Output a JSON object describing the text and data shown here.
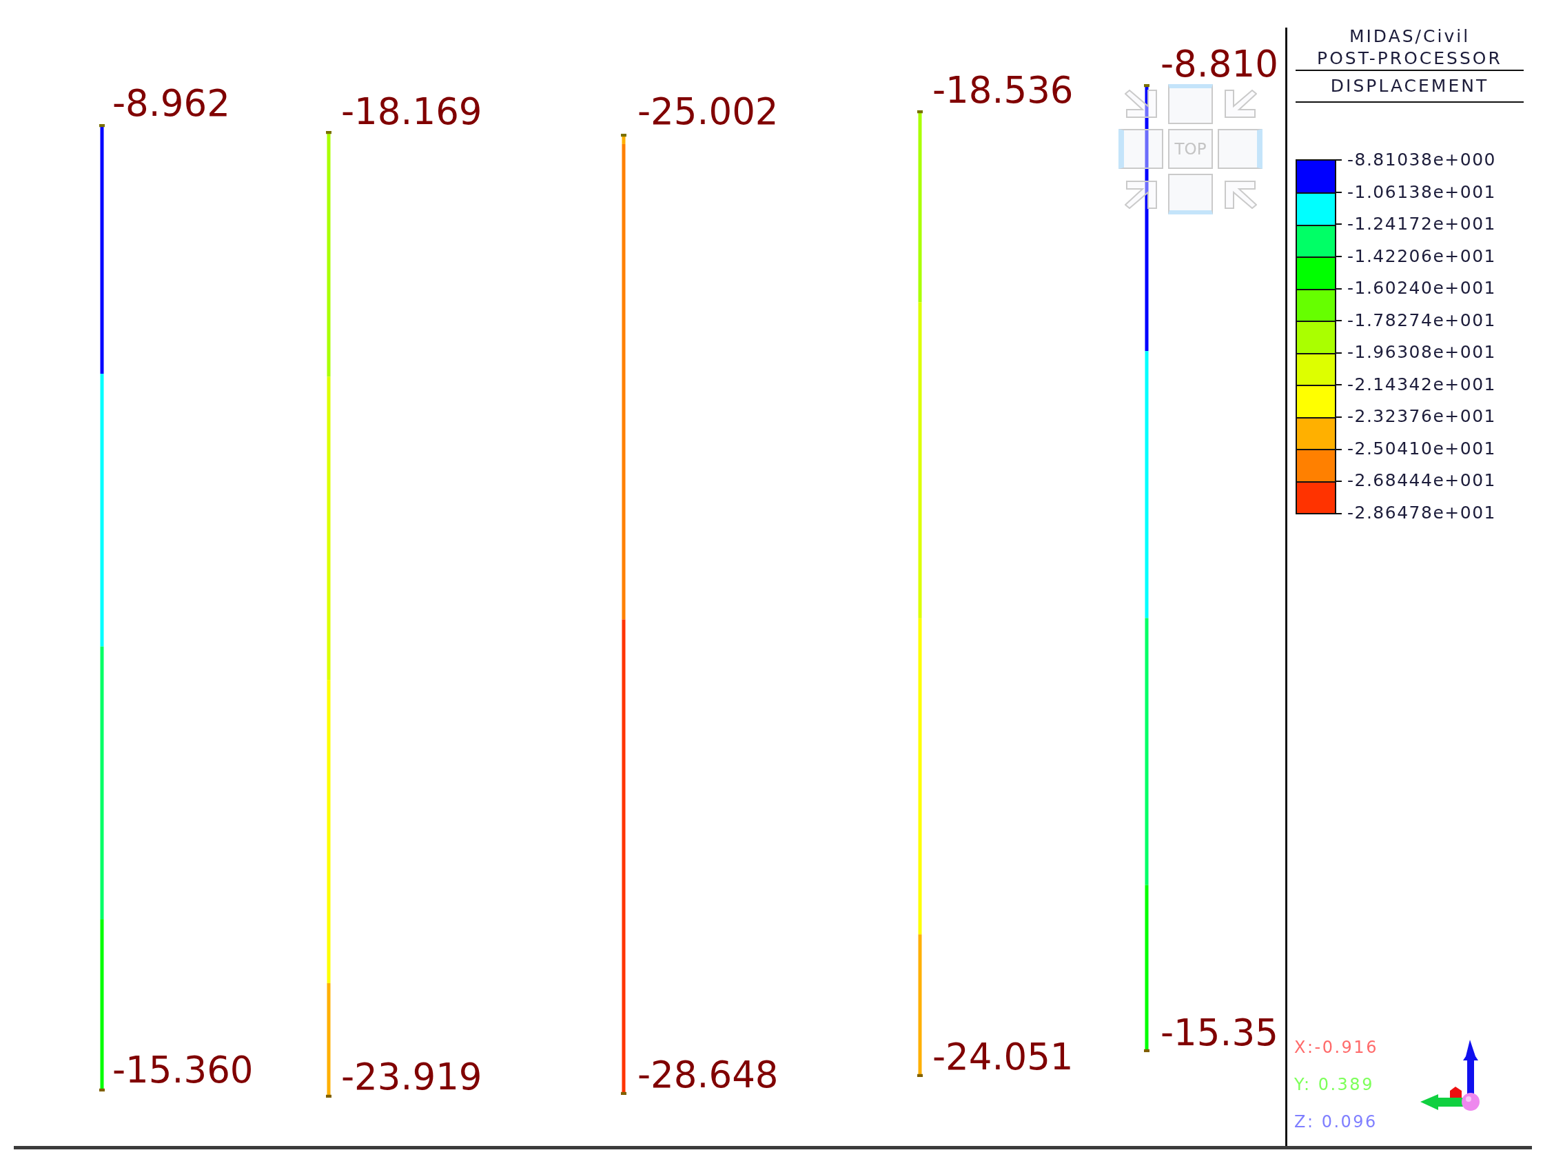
{
  "view": {
    "members": [
      {
        "top_value": "-8.962",
        "bottom_value": "-15.360"
      },
      {
        "top_value": "-18.169",
        "bottom_value": "-23.919"
      },
      {
        "top_value": "-25.002",
        "bottom_value": "-28.648"
      },
      {
        "top_value": "-18.536",
        "bottom_value": "-24.051"
      },
      {
        "top_value": "-8.810",
        "bottom_value": "-15.35"
      }
    ],
    "view_cube": {
      "face": "TOP"
    }
  },
  "legend": {
    "program": "MIDAS/Civil",
    "module": "POST-PROCESSOR",
    "result": "DISPLACEMENT",
    "bands": [
      {
        "color": "#0000ff"
      },
      {
        "color": "#00ffff"
      },
      {
        "color": "#00ff66"
      },
      {
        "color": "#00ff00"
      },
      {
        "color": "#66ff00"
      },
      {
        "color": "#aaff00"
      },
      {
        "color": "#ddff00"
      },
      {
        "color": "#ffff00"
      },
      {
        "color": "#ffb000"
      },
      {
        "color": "#ff8000"
      },
      {
        "color": "#ff3300"
      }
    ],
    "ticks": [
      "-8.81038e+000",
      "-1.06138e+001",
      "-1.24172e+001",
      "-1.42206e+001",
      "-1.60240e+001",
      "-1.78274e+001",
      "-1.96308e+001",
      "-2.14342e+001",
      "-2.32376e+001",
      "-2.50410e+001",
      "-2.68444e+001",
      "-2.86478e+001"
    ]
  },
  "orientation": [
    {
      "text": "X:-0.916",
      "color": "#ff6a6a"
    },
    {
      "text": "Y: 0.389",
      "color": "#7dff5a"
    },
    {
      "text": "Z: 0.096",
      "color": "#7f7fff"
    }
  ]
}
